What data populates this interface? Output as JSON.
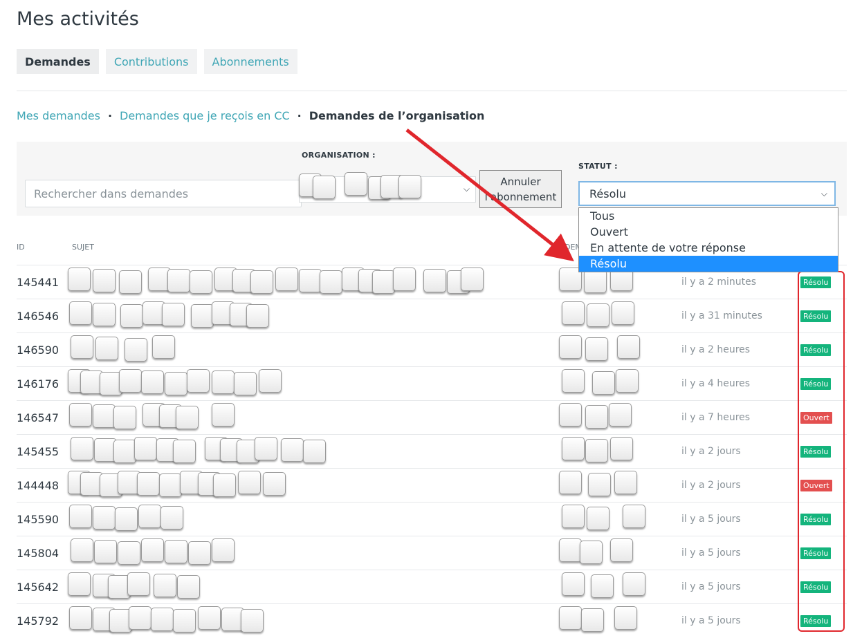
{
  "page": {
    "title": "Mes activités"
  },
  "tabs": [
    {
      "label": "Demandes"
    },
    {
      "label": "Contributions"
    },
    {
      "label": "Abonnements"
    }
  ],
  "subnav": {
    "mine": "Mes demandes",
    "cc": "Demandes que je reçois en CC",
    "org": "Demandes de l’organisation",
    "separator": "·"
  },
  "filters": {
    "search_placeholder": "Rechercher dans demandes",
    "organisation_label": "ORGANISATION :",
    "cancel_button": "Annuler l'abonnement",
    "statut_label": "STATUT :",
    "statut_value": "Résolu",
    "statut_options": [
      "Tous",
      "Ouvert",
      "En attente de votre réponse",
      "Résolu"
    ]
  },
  "table": {
    "headers": {
      "id": "ID",
      "subject": "SUJET",
      "requester": "DEM"
    },
    "rows": [
      {
        "id": "145441",
        "date": "il y a 2 minutes",
        "status": "Résolu"
      },
      {
        "id": "146546",
        "date": "il y a 31 minutes",
        "status": "Résolu"
      },
      {
        "id": "146590",
        "date": "il y a 2 heures",
        "status": "Résolu"
      },
      {
        "id": "146176",
        "date": "il y a 4 heures",
        "status": "Résolu"
      },
      {
        "id": "146547",
        "date": "il y a 7 heures",
        "status": "Ouvert"
      },
      {
        "id": "145455",
        "date": "il y a 2 jours",
        "status": "Résolu"
      },
      {
        "id": "144448",
        "date": "il y a 2 jours",
        "status": "Ouvert"
      },
      {
        "id": "145590",
        "date": "il y a 5 jours",
        "status": "Résolu"
      },
      {
        "id": "145804",
        "date": "il y a 5 jours",
        "status": "Résolu"
      },
      {
        "id": "145642",
        "date": "il y a 5 jours",
        "status": "Résolu"
      },
      {
        "id": "145792",
        "date": "il y a 5 jours",
        "status": "Résolu"
      }
    ]
  },
  "colors": {
    "accent": "#3fa6b5",
    "resolu": "#14b47c",
    "ouvert": "#e34f4f",
    "annotation": "#e0262c"
  }
}
